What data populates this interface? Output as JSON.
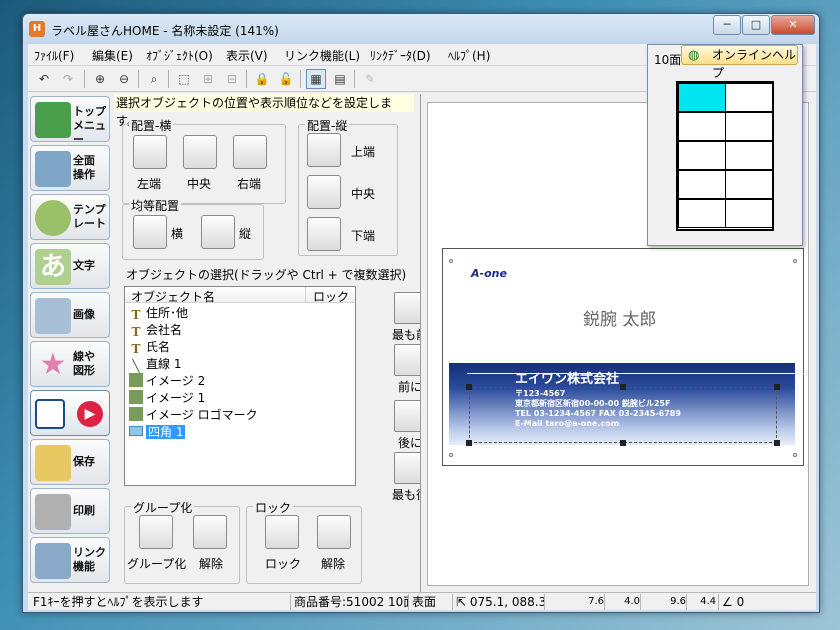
{
  "window": {
    "title": "ラベル屋さんHOME - 名称未設定 (141%)",
    "app_icon": "H",
    "controls": {
      "minimize": "─",
      "maximize": "□",
      "close": "✕"
    }
  },
  "menu": [
    "ﾌｧｲﾙ(F)",
    "編集(E)",
    "ｵﾌﾞｼﾞｪｸﾄ(O)",
    "表示(V)",
    "リンク機能(L)",
    "ﾘﾝｸﾃﾞｰﾀ(D)",
    "ﾍﾙﾌﾟ(H)"
  ],
  "toolbar_icons": [
    "undo-icon",
    "redo-icon",
    "zoom-in-icon",
    "zoom-out-icon",
    "zoom-fit-icon",
    "select-area-icon",
    "group-icon",
    "ungroup-icon",
    "lock-icon",
    "unlock-icon",
    "layout-icon",
    "layout-alt-icon",
    "disabled-icon"
  ],
  "nav": [
    {
      "label": "トップ\nメニュー",
      "icon": "home-icon",
      "color": "#4aa04a"
    },
    {
      "label": "全面\n操作",
      "icon": "all-operation-icon",
      "color": "#7fa6c8"
    },
    {
      "label": "テンプ\nレート",
      "icon": "template-disc-icon",
      "color": "#9ac06a"
    },
    {
      "label": "文字",
      "icon": "text-a-icon",
      "color": "#b0d090"
    },
    {
      "label": "画像",
      "icon": "image-icon",
      "color": "#a7c0d8"
    },
    {
      "label": "線や\n図形",
      "icon": "shapes-star-icon",
      "color": "#e0a0c0"
    },
    {
      "label": "",
      "icon": "object-arrange-icon",
      "color": "#dd2244"
    },
    {
      "label": "保存",
      "icon": "folder-save-icon",
      "color": "#e8c860"
    },
    {
      "label": "印刷",
      "icon": "printer-icon",
      "color": "#b0b0b0"
    },
    {
      "label": "リンク\n機能",
      "icon": "link-cards-icon",
      "color": "#8aa8c8"
    }
  ],
  "panel": {
    "hint": "選択オブジェクトの位置や表示順位などを設定します。",
    "align_h": {
      "title": "配置-横",
      "buttons": [
        "左端",
        "中央",
        "右端"
      ]
    },
    "align_v": {
      "title": "配置-縦",
      "buttons": [
        "上端",
        "中央",
        "下端"
      ]
    },
    "distribute": {
      "title": "均等配置",
      "buttons": [
        "横",
        "縦"
      ]
    },
    "select_label": "オブジェクトの選択(ドラッグや Ctrl + で複数選択)",
    "list_headers": {
      "name": "オブジェクト名",
      "lock": "ロック"
    },
    "objects": [
      {
        "name": "住所･他",
        "type": "text"
      },
      {
        "name": "会社名",
        "type": "text"
      },
      {
        "name": "氏名",
        "type": "text"
      },
      {
        "name": "直線 1",
        "type": "line"
      },
      {
        "name": "イメージ 2",
        "type": "image"
      },
      {
        "name": "イメージ 1",
        "type": "image"
      },
      {
        "name": "イメージ ロゴマーク",
        "type": "image"
      },
      {
        "name": "四角 1",
        "type": "rect",
        "selected": true
      }
    ],
    "order_buttons": [
      "最も前",
      "前に",
      "後に",
      "最も後"
    ],
    "group": {
      "title": "グループ化",
      "buttons": [
        "グループ化",
        "解除"
      ]
    },
    "lock": {
      "title": "ロック",
      "buttons": [
        "ロック",
        "解除"
      ]
    }
  },
  "card": {
    "name": "鋭腕 太郎",
    "company": "エイワン株式会社",
    "logo": "A-one",
    "address_lines": [
      "〒123-4567",
      "東京都新宿区新宿00-00-00 鋭腕ビル25F",
      "TEL 03-1234-4567  FAX 03-2345-6789",
      "E-Mail taro@a-one.com"
    ]
  },
  "popup": {
    "label": "10面",
    "help": "オンラインヘルプ",
    "grid_rows": 5,
    "grid_cols": 2,
    "highlight_color": "#00e5f0"
  },
  "status": {
    "hint": "F1ｷｰを押すとﾍﾙﾌﾟを表示します",
    "product": "商品番号:51002 10面",
    "side": "表面",
    "coords": "075.1, 088.3",
    "w": "7.6",
    "h": "4.0",
    "x2": "9.6",
    "y2": "4.4",
    "angle": "0"
  }
}
